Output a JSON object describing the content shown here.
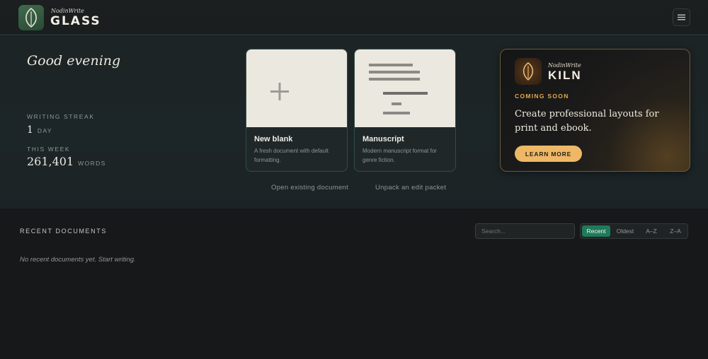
{
  "app": {
    "brand_sub": "NodinWrite",
    "brand_name": "GLASS",
    "icons": {
      "logo": "leaf-icon",
      "menu": "hamburger-menu-icon"
    }
  },
  "hero": {
    "greeting": "Good evening",
    "streak_label": "WRITING STREAK",
    "streak_value": "1",
    "streak_unit": "DAY",
    "week_label": "THIS WEEK",
    "week_value": "261,401",
    "week_unit": "WORDS",
    "templates": [
      {
        "title": "New blank",
        "description": "A fresh document with default formatting.",
        "icon": "plus-icon"
      },
      {
        "title": "Manuscript",
        "description": "Modern manuscript format for genre fiction.",
        "icon": "manuscript-page-icon"
      }
    ],
    "links": {
      "open_existing": "Open existing document",
      "unpack_packet": "Unpack an edit packet"
    }
  },
  "kiln": {
    "sub": "NodinWrite",
    "name": "KILN",
    "badge": "COMING SOON",
    "text": "Create professional layouts for print and ebook.",
    "button": "LEARN MORE",
    "accent": "#efb866"
  },
  "recent": {
    "title": "RECENT DOCUMENTS",
    "search_placeholder": "Search...",
    "sort_options": [
      "Recent",
      "Oldest",
      "A–Z",
      "Z–A"
    ],
    "sort_selected": "Recent",
    "empty_message": "No recent documents yet. Start writing."
  },
  "colors": {
    "accent_green": "#1f7a59",
    "background": "#171819",
    "hero_background": "#1c2527"
  }
}
